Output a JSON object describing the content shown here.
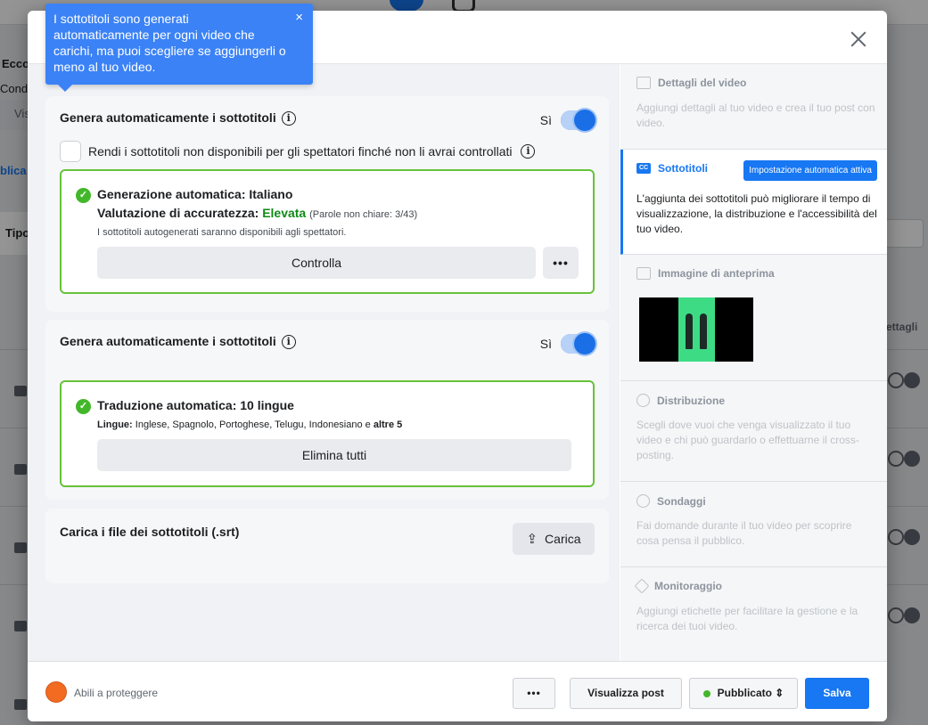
{
  "background": {
    "text_1": "Ecco",
    "text_2": "Cond",
    "text_3": "Vis",
    "text_4": "blica",
    "text_5": "Tipo",
    "text_6": "ettagli"
  },
  "tooltip": {
    "text": "I sottotitoli sono generati automaticamente per ogni video che carichi, ma puoi scegliere se aggiungerli o meno al tuo video.",
    "close": "×"
  },
  "section1": {
    "title": "Genera automaticamente i sottotitoli",
    "toggle_label": "Sì",
    "checkbox_label": "Rendi i sottotitoli non disponibili per gli spettatori finché non li avrai controllati",
    "box_title": "Generazione automatica: Italiano",
    "accuracy_label": "Valutazione di accuratezza:",
    "accuracy_value": "Elevata",
    "accuracy_detail": "(Parole non chiare: 3/43)",
    "note": "I sottotitoli autogenerati saranno disponibili agli spettatori.",
    "review_button": "Controlla",
    "more_button": "•••"
  },
  "section2": {
    "title": "Genera automaticamente i sottotitoli",
    "toggle_label": "Sì",
    "box_title": "Traduzione automatica: 10 lingue",
    "languages_label": "Lingue:",
    "languages_list": "Inglese, Spagnolo, Portoghese, Telugu, Indonesiano e",
    "languages_more": "altre 5",
    "delete_button": "Elimina tutti"
  },
  "section3": {
    "title": "Carica i file dei sottotitoli (.srt)",
    "upload_button": "Carica"
  },
  "steps": [
    {
      "title": "Dettagli del video",
      "desc": "Aggiungi dettagli al tuo video e crea il tuo post con video."
    },
    {
      "title": "Sottotitoli",
      "badge": "Impostazione automatica attiva",
      "desc": "L'aggiunta dei sottotitoli può migliorare il tempo di visualizzazione, la distribuzione e l'accessibilità del tuo video."
    },
    {
      "title": "Immagine di anteprima"
    },
    {
      "title": "Distribuzione",
      "desc": "Scegli dove vuoi che venga visualizzato il tuo video e chi può guardarlo o effettuarne il cross-posting."
    },
    {
      "title": "Sondaggi",
      "desc": "Fai domande durante il tuo video per scoprire cosa pensa il pubblico."
    },
    {
      "title": "Monitoraggio",
      "desc": "Aggiungi etichette per facilitare la gestione e la ricerca dei tuoi video."
    }
  ],
  "footer": {
    "page_name": "Abili a proteggere",
    "more_button": "•••",
    "preview_button": "Visualizza post",
    "status_button": "Pubblicato ⇕",
    "save_button": "Salva"
  },
  "colors": {
    "accent": "#1877f2",
    "success": "#42b72a",
    "accuracy_green": "#0f8a16",
    "tooltip_blue": "#3b82f6"
  }
}
